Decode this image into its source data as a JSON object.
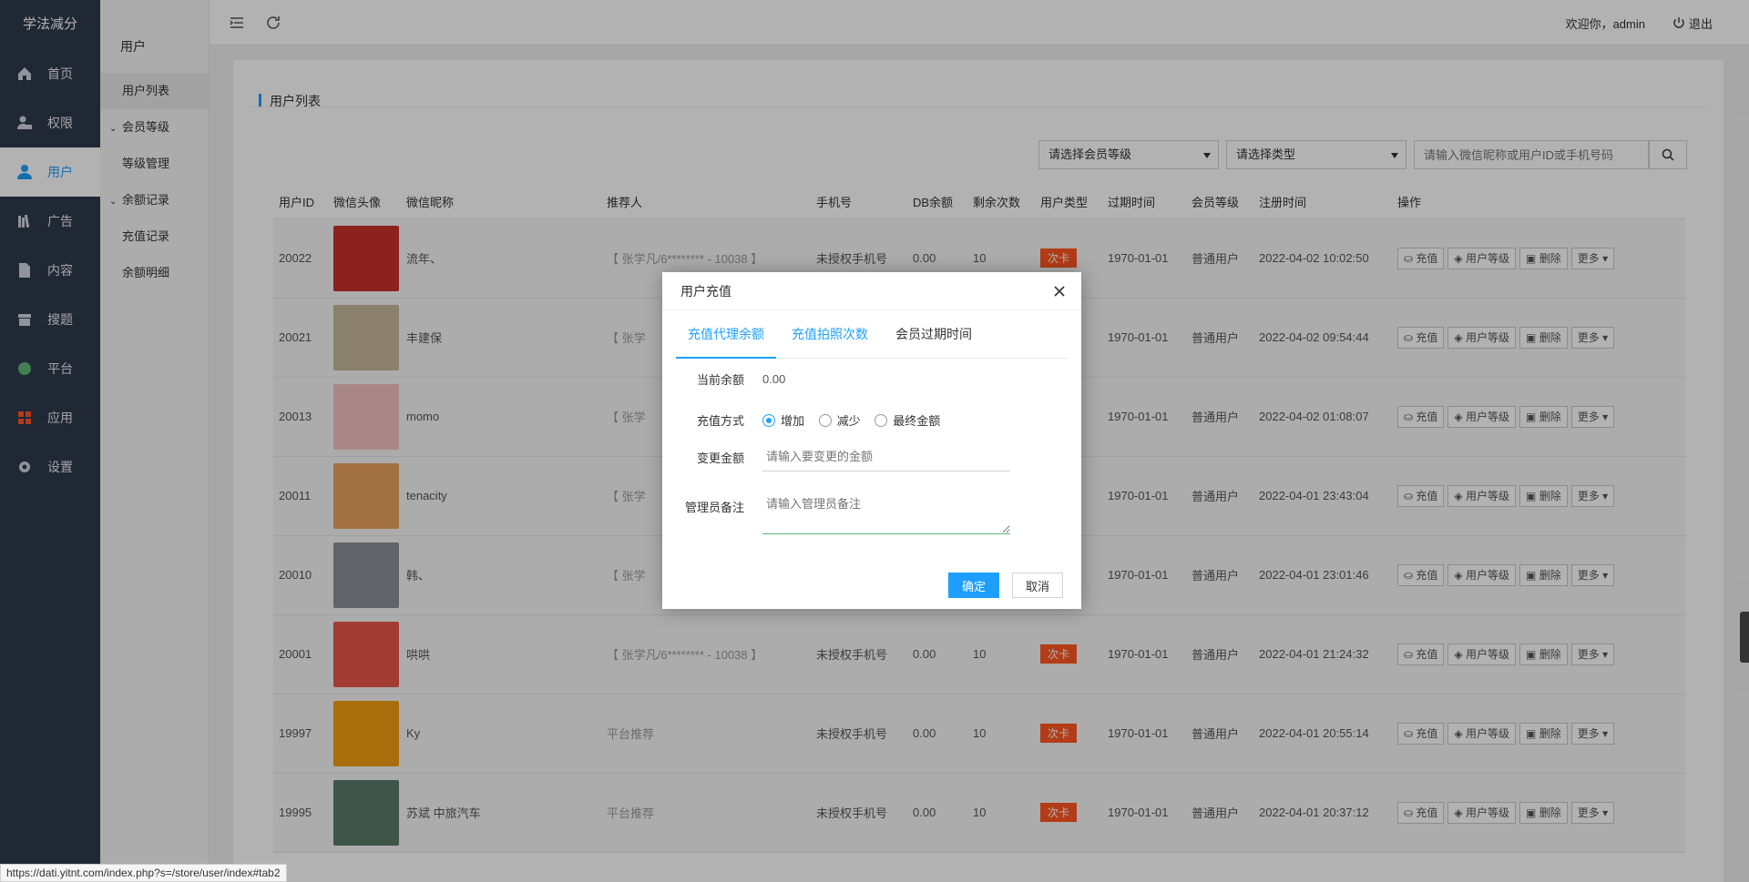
{
  "brand": "学法减分",
  "nav": [
    {
      "label": "首页",
      "icon": "home-icon"
    },
    {
      "label": "权限",
      "icon": "user-lock-icon"
    },
    {
      "label": "用户",
      "icon": "user-icon"
    },
    {
      "label": "广告",
      "icon": "bookshelf-icon"
    },
    {
      "label": "内容",
      "icon": "document-icon"
    },
    {
      "label": "搜题",
      "icon": "archive-icon"
    },
    {
      "label": "平台",
      "icon": "platform-icon"
    },
    {
      "label": "应用",
      "icon": "apps-icon"
    },
    {
      "label": "设置",
      "icon": "gear-icon"
    }
  ],
  "subnav": {
    "title": "用户",
    "items": [
      "用户列表"
    ],
    "groups": [
      {
        "label": "会员等级",
        "children": [
          "等级管理"
        ]
      },
      {
        "label": "余额记录",
        "children": [
          "充值记录",
          "余额明细"
        ]
      }
    ]
  },
  "topbar": {
    "welcome": "欢迎你，admin",
    "logout": "退出"
  },
  "card": {
    "title": "用户列表"
  },
  "filters": {
    "level_placeholder": "请选择会员等级",
    "type_placeholder": "请选择类型",
    "search_placeholder": "请输入微信昵称或用户ID或手机号码"
  },
  "table": {
    "headers": [
      "用户ID",
      "微信头像",
      "微信昵称",
      "推荐人",
      "手机号",
      "DB余额",
      "剩余次数",
      "用户类型",
      "过期时间",
      "会员等级",
      "注册时间",
      "操作"
    ],
    "rows": [
      {
        "id": "20022",
        "nick": "流年、",
        "ref": "【 张学凡/6******** - 10038 】",
        "phone": "未授权手机号",
        "balance": "0.00",
        "times": "10",
        "type": "次卡",
        "expire": "1970-01-01",
        "level": "普通用户",
        "reg": "2022-04-02 10:02:50",
        "avatar_color": "#c9302c"
      },
      {
        "id": "20021",
        "nick": "丰建保",
        "ref": "【 张学",
        "phone": "",
        "balance": "",
        "times": "",
        "type": "",
        "expire": "1970-01-01",
        "level": "普通用户",
        "reg": "2022-04-02 09:54:44",
        "avatar_color": "#c8b89a"
      },
      {
        "id": "20013",
        "nick": "momo",
        "ref": "【 张学",
        "phone": "",
        "balance": "",
        "times": "",
        "type": "",
        "expire": "1970-01-01",
        "level": "普通用户",
        "reg": "2022-04-02 01:08:07",
        "avatar_color": "#f4c2c2"
      },
      {
        "id": "20011",
        "nick": "tenacity",
        "ref": "【 张学",
        "phone": "",
        "balance": "",
        "times": "",
        "type": "",
        "expire": "1970-01-01",
        "level": "普通用户",
        "reg": "2022-04-01 23:43:04",
        "avatar_color": "#e9a35f"
      },
      {
        "id": "20010",
        "nick": "韩、",
        "ref": "【 张学",
        "phone": "",
        "balance": "",
        "times": "",
        "type": "",
        "expire": "1970-01-01",
        "level": "普通用户",
        "reg": "2022-04-01 23:01:46",
        "avatar_color": "#8a8f96"
      },
      {
        "id": "20001",
        "nick": "哄哄",
        "ref": "【 张学凡/6******** - 10038 】",
        "phone": "未授权手机号",
        "balance": "0.00",
        "times": "10",
        "type": "次卡",
        "expire": "1970-01-01",
        "level": "普通用户",
        "reg": "2022-04-01 21:24:32",
        "avatar_color": "#e8564a"
      },
      {
        "id": "19997",
        "nick": "Ky",
        "ref": "平台推荐",
        "phone": "未授权手机号",
        "balance": "0.00",
        "times": "10",
        "type": "次卡",
        "expire": "1970-01-01",
        "level": "普通用户",
        "reg": "2022-04-01 20:55:14",
        "avatar_color": "#f39c12"
      },
      {
        "id": "19995",
        "nick": "苏斌 中旅汽车",
        "ref": "平台推荐",
        "phone": "未授权手机号",
        "balance": "0.00",
        "times": "10",
        "type": "次卡",
        "expire": "1970-01-01",
        "level": "普通用户",
        "reg": "2022-04-01 20:37:12",
        "avatar_color": "#5b7a6a"
      }
    ],
    "ops": [
      "充值",
      "用户等级",
      "删除",
      "更多"
    ]
  },
  "modal": {
    "title": "用户充值",
    "tabs": [
      "充值代理余额",
      "充值拍照次数",
      "会员过期时间"
    ],
    "balance_label": "当前余额",
    "balance_value": "0.00",
    "method_label": "充值方式",
    "methods": [
      "增加",
      "减少",
      "最终金额"
    ],
    "amount_label": "变更金额",
    "amount_placeholder": "请输入要变更的金额",
    "remark_label": "管理员备注",
    "remark_placeholder": "请输入管理员备注",
    "confirm": "确定",
    "cancel": "取消"
  },
  "statusbar": "https://dati.yitnt.com/index.php?s=/store/user/index#tab2"
}
